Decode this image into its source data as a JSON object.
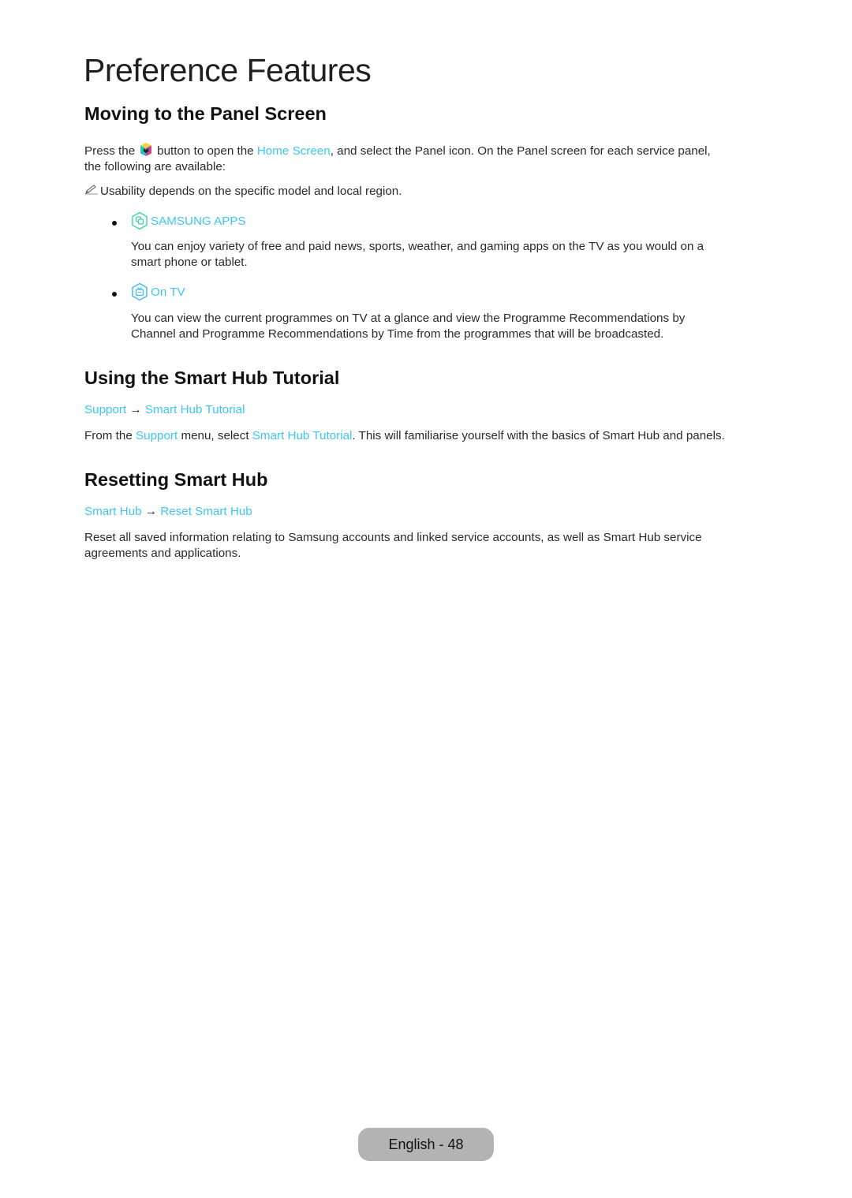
{
  "page_title": "Preference Features",
  "colors": {
    "link": "#3cc7f2",
    "samsung_apps_icon": "#3ad3a0",
    "on_tv_icon": "#3cb8f2",
    "footer_bg": "#b3b3b3"
  },
  "section1": {
    "heading": "Moving to the Panel Screen",
    "intro_part1": "Press the",
    "home_button_icon": "smart-hub-button-icon",
    "intro_part2": "button to open the",
    "home_screen_link": "Home Screen",
    "intro_part3": ", and select the Panel icon. On the Panel screen for each service panel,",
    "intro_line2": "the following are available:",
    "note_icon": "pencil-note-icon",
    "note": "Usability depends on the specific model and local region.",
    "items": [
      {
        "icon": "samsung-apps-icon",
        "title": "SAMSUNG APPS",
        "desc_line1": "You can enjoy variety of free and paid news, sports, weather, and gaming apps on the TV as you would on a",
        "desc_line2": "smart phone or tablet."
      },
      {
        "icon": "on-tv-icon",
        "title": "On TV",
        "desc_line1": "You can view the current programmes on TV at a glance and view the Programme Recommendations by",
        "desc_line2": "Channel and Programme Recommendations by Time from the programmes that will be broadcasted."
      }
    ]
  },
  "section2": {
    "heading": "Using the Smart Hub Tutorial",
    "breadcrumb": {
      "first": "Support",
      "arrow": "→",
      "second": "Smart Hub Tutorial"
    },
    "body_part1": "From the",
    "body_link1": "Support",
    "body_part2": "menu, select",
    "body_link2": "Smart Hub Tutorial",
    "body_part3": ". This will familiarise yourself with the basics of Smart Hub and panels."
  },
  "section3": {
    "heading": "Resetting Smart Hub",
    "breadcrumb": {
      "first": "Smart Hub",
      "arrow": "→",
      "second": "Reset Smart Hub"
    },
    "body_line1": "Reset all saved information relating to Samsung accounts and linked service accounts, as well as Smart Hub service",
    "body_line2": "agreements and applications."
  },
  "footer": {
    "label": "English - 48"
  }
}
